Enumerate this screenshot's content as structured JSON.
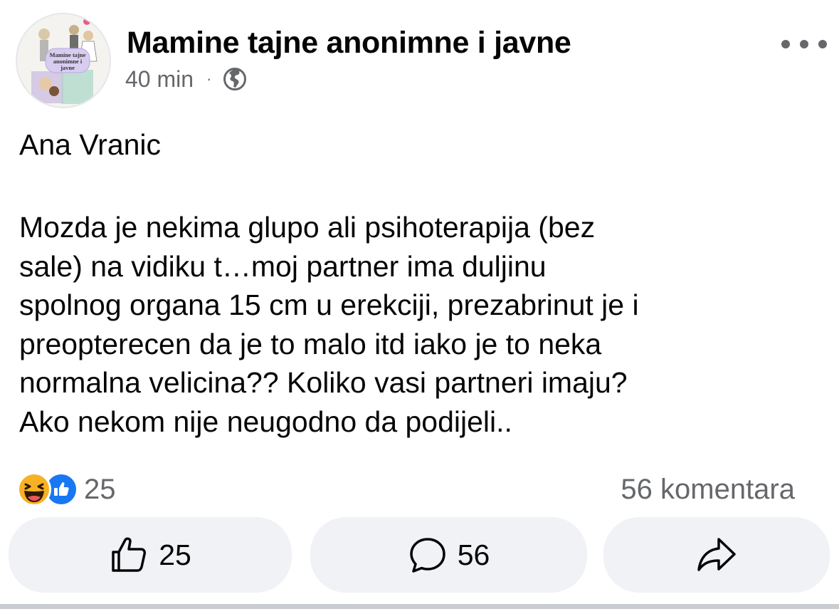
{
  "post": {
    "page_name": "Mamine tajne anonimne i javne",
    "avatar_caption": "Mamine tajne anonimne i javne",
    "time": "40 min",
    "separator": "·",
    "audience_icon": "globe-icon",
    "more_icon": "more-horizontal-icon",
    "author": "Ana Vranic",
    "text": "Mozda je nekima glupo ali psihoterapija (bez sale) na vidiku t…moj partner ima duljinu spolnog organa 15 cm u erekciji, prezabrinut je i preopterecen da je to malo itd iako je to neka normalna velicina?? Koliko vasi partneri imaju? Ako nekom nije neugodno da podijeli..",
    "lines": [
      "Mozda je nekima glupo ali psihoterapija (bez",
      "sale) na vidiku t…moj partner ima duljinu",
      "spolnog organa 15 cm u erekciji, prezabrinut je i",
      "preopterecen da je to malo itd iako je to neka",
      "normalna velicina?? Koliko vasi partneri imaju?",
      "Ako nekom nije neugodno da podijeli.."
    ]
  },
  "stats": {
    "reaction_icons": [
      "haha-icon",
      "like-icon"
    ],
    "reaction_count": "25",
    "comments": "56 komentara"
  },
  "actions": {
    "like": {
      "icon": "thumbs-up-icon",
      "count": "25"
    },
    "comment": {
      "icon": "comment-bubble-icon",
      "count": "56"
    },
    "share": {
      "icon": "share-arrow-icon"
    }
  },
  "colors": {
    "text": "#050505",
    "secondary": "#65676b",
    "button_bg": "#f0f2f5",
    "like_blue": "#1877f2",
    "haha_yellow": "#f7b125"
  }
}
